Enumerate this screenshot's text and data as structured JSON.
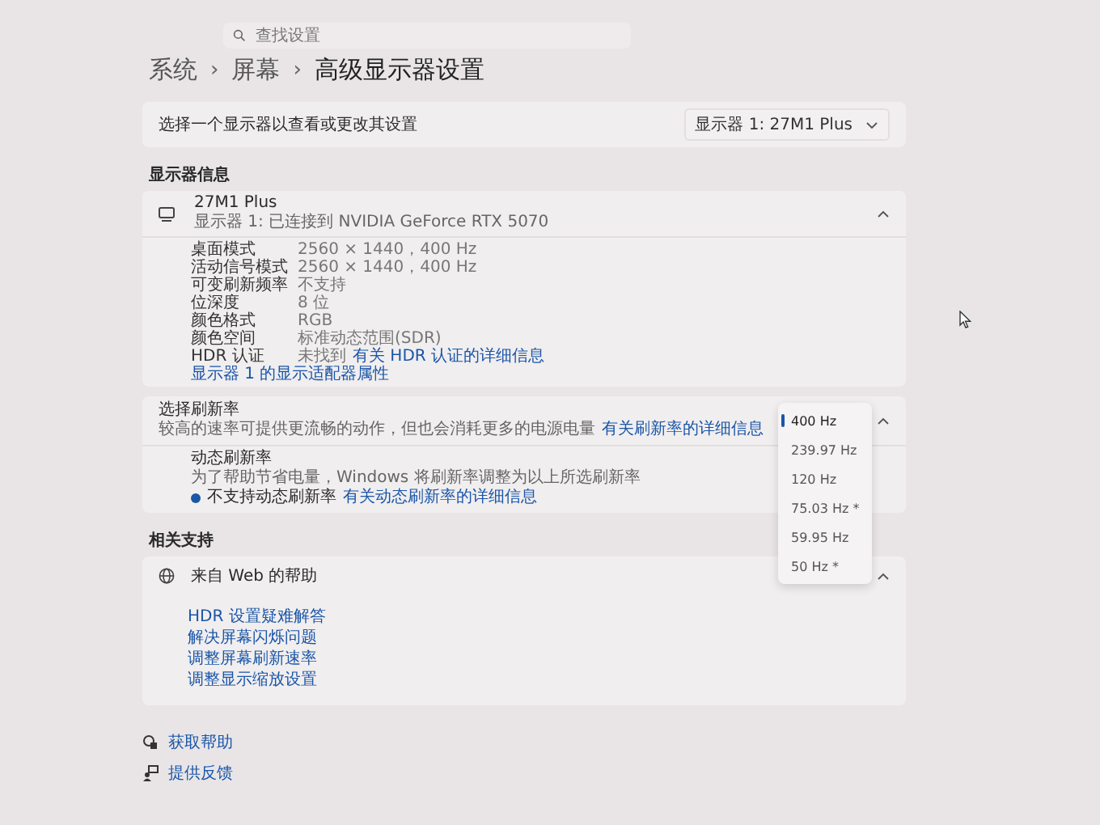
{
  "search": {
    "placeholder": "查找设置"
  },
  "breadcrumb": [
    {
      "kind": "crumb",
      "label": "系统"
    },
    {
      "kind": "separator",
      "label": "›"
    },
    {
      "kind": "crumb",
      "label": "屏幕"
    },
    {
      "kind": "separator",
      "label": "›"
    },
    {
      "kind": "current",
      "label": "高级显示器设置"
    }
  ],
  "display_select": {
    "label": "选择一个显示器以查看或更改其设置",
    "dropdown": "显示器 1: 27M1 Plus"
  },
  "display_info": {
    "heading": "显示器信息",
    "name": "27M1 Plus",
    "subtitle": "显示器 1: 已连接到 NVIDIA GeForce RTX 5070",
    "expanded": true,
    "rows": [
      {
        "label": "桌面模式",
        "value": "2560 × 1440，400 Hz"
      },
      {
        "label": "活动信号模式",
        "value": "2560 × 1440，400 Hz"
      },
      {
        "label": "可变刷新频率",
        "value": "不支持"
      },
      {
        "label": "位深度",
        "value": "8 位"
      },
      {
        "label": "颜色格式",
        "value": "RGB"
      },
      {
        "label": "颜色空间",
        "value": "标准动态范围(SDR)"
      },
      {
        "label": "HDR 认证",
        "value": "未找到",
        "link": "有关 HDR 认证的详细信息"
      }
    ],
    "adapter_link": "显示器 1 的显示适配器属性"
  },
  "refresh": {
    "title": "选择刷新率",
    "description": "较高的速率可提供更流畅的动作，但也会消耗更多的电源电量",
    "link": "有关刷新率的详细信息",
    "expanded": true,
    "dynamic": {
      "title": "动态刷新率",
      "description": "为了帮助节省电量，Windows 将刷新率调整为以上所选刷新率",
      "status": "不支持动态刷新率",
      "link": "有关动态刷新率的详细信息"
    },
    "options": [
      {
        "label": "400 Hz",
        "selected": true
      },
      {
        "label": "239.97 Hz",
        "selected": false
      },
      {
        "label": "120 Hz",
        "selected": false
      },
      {
        "label": "75.03 Hz *",
        "selected": false
      },
      {
        "label": "59.95 Hz",
        "selected": false
      },
      {
        "label": "50 Hz *",
        "selected": false
      }
    ]
  },
  "related": {
    "heading": "相关支持",
    "web_help": {
      "title": "来自 Web 的帮助",
      "expanded": true,
      "links": [
        "HDR 设置疑难解答",
        "解决屏幕闪烁问题",
        "调整屏幕刷新速率",
        "调整显示缩放设置"
      ]
    }
  },
  "footer": [
    {
      "kind": "help",
      "label": "获取帮助"
    },
    {
      "kind": "feedback",
      "label": "提供反馈"
    }
  ]
}
